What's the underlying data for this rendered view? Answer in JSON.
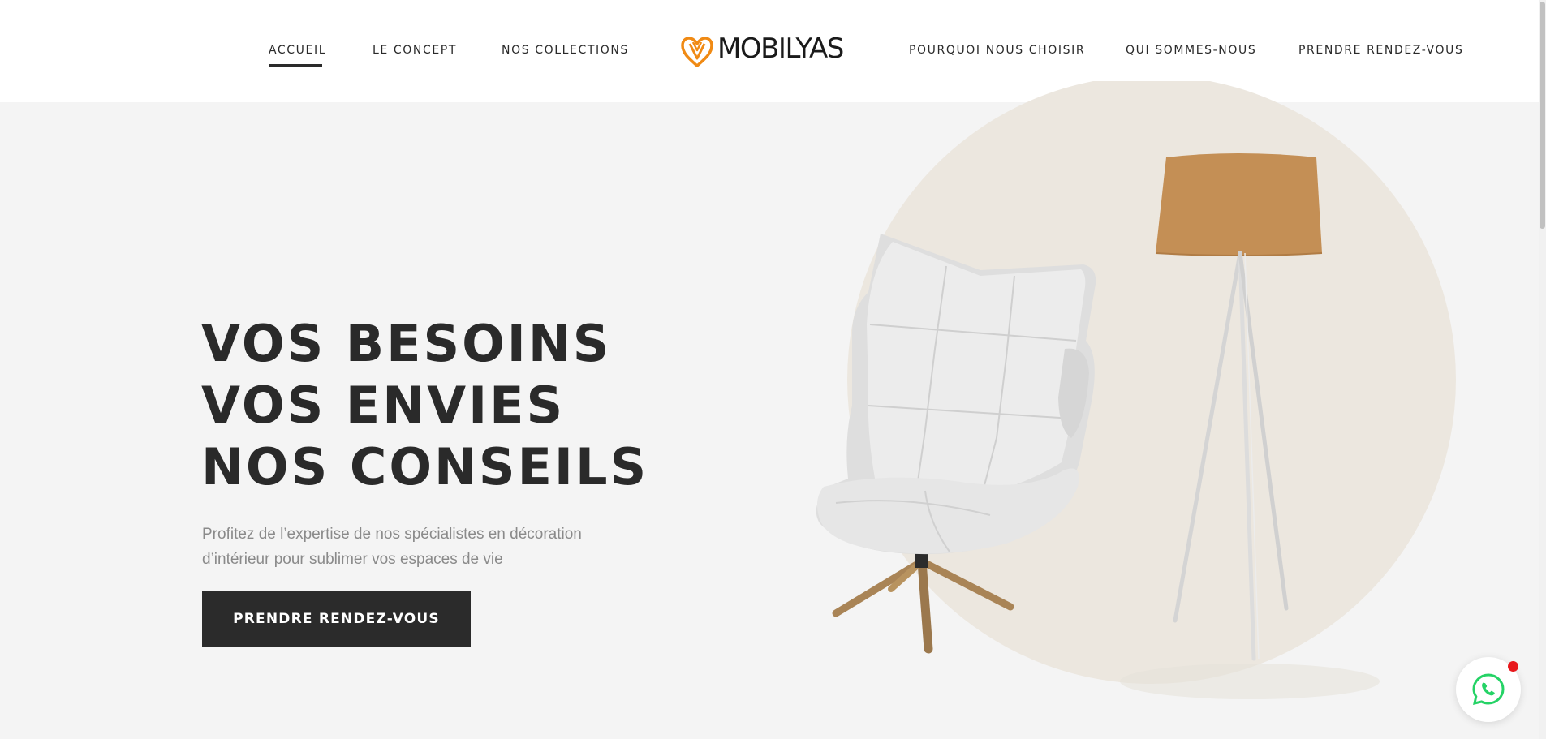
{
  "header": {
    "nav_left": [
      {
        "label": "ACCUEIL",
        "active": true
      },
      {
        "label": "LE CONCEPT",
        "active": false
      },
      {
        "label": "NOS COLLECTIONS",
        "active": false
      }
    ],
    "logo_text": "MOBILYAS",
    "nav_right": [
      {
        "label": "POURQUOI NOUS CHOISIR",
        "active": false
      },
      {
        "label": "QUI SOMMES-NOUS",
        "active": false
      },
      {
        "label": "PRENDRE RENDEZ-VOUS",
        "active": false
      }
    ]
  },
  "hero": {
    "title_lines": [
      "VOS BESOINS",
      "VOS ENVIES",
      "NOS CONSEILS"
    ],
    "subtitle": "Profitez de l’expertise de nos spécialistes en décoration d’intérieur pour sublimer vos espaces de vie",
    "cta_label": "PRENDRE RENDEZ-VOUS"
  },
  "icons": {
    "logo": "heart-logo-icon",
    "whatsapp": "whatsapp-icon"
  },
  "colors": {
    "brand_orange": "#f08a14",
    "dark": "#2b2b2b",
    "background": "#f4f4f4",
    "circle": "#ece7df",
    "lamp_shade": "#c48f55",
    "whatsapp_green": "#25d366",
    "notification": "#e8181c"
  }
}
